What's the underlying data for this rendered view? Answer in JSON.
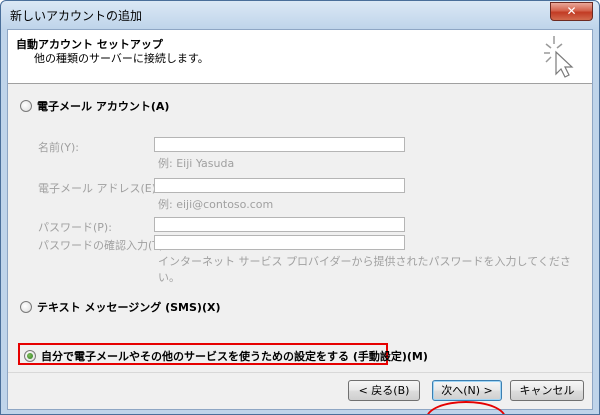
{
  "window": {
    "title": "新しいアカウントの追加",
    "close_label": "✕"
  },
  "header": {
    "title": "自動アカウント セットアップ",
    "subtitle": "他の種類のサーバーに接続します。"
  },
  "options": {
    "email": {
      "label": "電子メール アカウント(A)",
      "fields": {
        "name_label": "名前(Y):",
        "name_hint": "例: Eiji Yasuda",
        "email_label": "電子メール アドレス(E):",
        "email_hint": "例: eiji@contoso.com",
        "password_label": "パスワード(P):",
        "confirm_label": "パスワードの確認入力(T):",
        "password_hint": "インターネット サービス プロバイダーから提供されたパスワードを入力してください。"
      }
    },
    "sms": {
      "label": "テキスト メッセージング (SMS)(X)"
    },
    "manual": {
      "label": "自分で電子メールやその他のサービスを使うための設定をする (手動設定)(M)",
      "selected": true
    }
  },
  "footer": {
    "back_label": "< 戻る(B)",
    "next_label": "次へ(N) >",
    "cancel_label": "キャンセル"
  },
  "colors": {
    "highlight": "#e60000",
    "titlebar": "#bfd4ea"
  }
}
